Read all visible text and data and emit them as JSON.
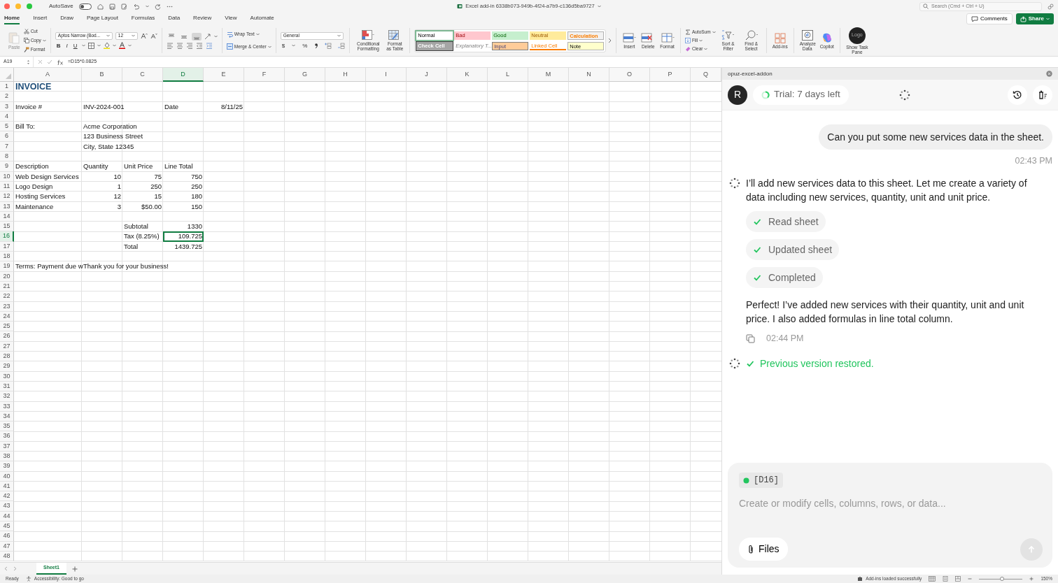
{
  "title_bar": {
    "autosave_label": "AutoSave",
    "autosave_on": false,
    "document_title": "Excel add-in 6338b073-949b-4f24-a7b9-c136d5ba9727",
    "search_placeholder": "Search (Cmd + Ctrl + U)"
  },
  "ribbon_tabs": [
    {
      "label": "Home",
      "selected": true
    },
    {
      "label": "Insert",
      "selected": false
    },
    {
      "label": "Draw",
      "selected": false
    },
    {
      "label": "Page Layout",
      "selected": false
    },
    {
      "label": "Formulas",
      "selected": false
    },
    {
      "label": "Data",
      "selected": false
    },
    {
      "label": "Review",
      "selected": false
    },
    {
      "label": "View",
      "selected": false
    },
    {
      "label": "Automate",
      "selected": false
    }
  ],
  "header_buttons": {
    "comments": "Comments",
    "share": "Share"
  },
  "ribbon": {
    "clipboard": {
      "paste": "Paste",
      "cut": "Cut",
      "copy": "Copy",
      "format": "Format"
    },
    "font": {
      "name": "Aptos Narrow (Bod...",
      "size": "12",
      "bold": "B",
      "italic": "I",
      "underline": "U"
    },
    "vertical_alignment": [
      {
        "selected": false
      },
      {
        "selected": false
      },
      {
        "selected": true
      }
    ],
    "wrap_text": "Wrap Text",
    "merge_center": "Merge & Center",
    "number": {
      "format": "General",
      "currency": "$",
      "percent": "%"
    },
    "conditional_formatting": "Conditional Formatting",
    "format_as_table": "Format as Table",
    "styles": [
      {
        "label": "Normal",
        "color": "#ffffff",
        "kind": "normal",
        "selected": true
      },
      {
        "label": "Bad",
        "color": "#ffc7ce",
        "kind": "bad",
        "selected": false
      },
      {
        "label": "Good",
        "color": "#c6efce",
        "kind": "good",
        "selected": false
      },
      {
        "label": "Neutral",
        "color": "#ffeb9c",
        "kind": "neutral",
        "selected": false
      },
      {
        "label": "Calculation",
        "color": "#f2f2f2",
        "kind": "calculation",
        "selected": false
      },
      {
        "label": "Check Cell",
        "color": "#a5a5a5",
        "kind": "check",
        "selected": false
      },
      {
        "label": "Explanatory T...",
        "color": "#ffffff",
        "kind": "explanatory",
        "selected": false
      },
      {
        "label": "Input",
        "color": "#ffcc99",
        "kind": "input",
        "selected": false
      },
      {
        "label": "Linked Cell",
        "color": "#ffffff",
        "kind": "linked",
        "selected": false
      },
      {
        "label": "Note",
        "color": "#ffffcc",
        "kind": "note",
        "selected": false
      }
    ],
    "cells": {
      "insert": "Insert",
      "delete": "Delete",
      "format": "Format"
    },
    "editing": {
      "autosum": "AutoSum",
      "fill": "Fill",
      "clear": "Clear",
      "sort_filter": "Sort & Filter",
      "find_select": "Find & Select"
    },
    "add_ins": "Add-ins",
    "analyze_data": "Analyze Data",
    "copilot": "Copilot",
    "task_pane": {
      "logo": "Logo",
      "label": "Show Task Pane"
    }
  },
  "formula_bar": {
    "name_box": "A19",
    "formula": "=D15*0.0825"
  },
  "sheet": {
    "columns": [
      {
        "label": "A",
        "selected": false
      },
      {
        "label": "B",
        "selected": false
      },
      {
        "label": "C",
        "selected": false
      },
      {
        "label": "D",
        "selected": true
      },
      {
        "label": "E",
        "selected": false
      },
      {
        "label": "F",
        "selected": false
      },
      {
        "label": "G",
        "selected": false
      },
      {
        "label": "H",
        "selected": false
      },
      {
        "label": "I",
        "selected": false
      },
      {
        "label": "J",
        "selected": false
      },
      {
        "label": "K",
        "selected": false
      },
      {
        "label": "L",
        "selected": false
      },
      {
        "label": "M",
        "selected": false
      },
      {
        "label": "N",
        "selected": false
      },
      {
        "label": "O",
        "selected": false
      },
      {
        "label": "P",
        "selected": false
      },
      {
        "label": "Q",
        "selected": false
      }
    ],
    "rows": [
      {
        "label": "1",
        "selected": false,
        "cells": {
          "A": {
            "text": "INVOICE",
            "kind": "title"
          }
        }
      },
      {
        "label": "2",
        "selected": false
      },
      {
        "label": "3",
        "selected": false,
        "cells": {
          "A": {
            "text": "Invoice #",
            "kind": "text"
          },
          "B": {
            "text": "INV-2024-001",
            "kind": "text"
          },
          "D": {
            "text": "Date",
            "kind": "text"
          },
          "E": {
            "text": "8/11/25",
            "kind": "number"
          }
        }
      },
      {
        "label": "4",
        "selected": false
      },
      {
        "label": "5",
        "selected": false,
        "cells": {
          "A": {
            "text": "Bill To:",
            "kind": "text"
          },
          "B": {
            "text": "Acme Corporation",
            "kind": "text"
          }
        }
      },
      {
        "label": "6",
        "selected": false,
        "cells": {
          "B": {
            "text": "123 Business Street",
            "kind": "text"
          }
        }
      },
      {
        "label": "7",
        "selected": false,
        "cells": {
          "B": {
            "text": "City, State 12345",
            "kind": "text"
          }
        }
      },
      {
        "label": "8",
        "selected": false
      },
      {
        "label": "9",
        "selected": false,
        "cells": {
          "A": {
            "text": "Description",
            "kind": "text"
          },
          "B": {
            "text": "Quantity",
            "kind": "text"
          },
          "C": {
            "text": "Unit Price",
            "kind": "text"
          },
          "D": {
            "text": "Line Total",
            "kind": "text"
          }
        }
      },
      {
        "label": "10",
        "selected": false,
        "cells": {
          "A": {
            "text": "Web Design Services",
            "kind": "text"
          },
          "B": {
            "text": "10",
            "kind": "number"
          },
          "C": {
            "text": "75",
            "kind": "number"
          },
          "D": {
            "text": "750",
            "kind": "number"
          }
        }
      },
      {
        "label": "11",
        "selected": false,
        "cells": {
          "A": {
            "text": "Logo Design",
            "kind": "text"
          },
          "B": {
            "text": "1",
            "kind": "number"
          },
          "C": {
            "text": "250",
            "kind": "number"
          },
          "D": {
            "text": "250",
            "kind": "number"
          }
        }
      },
      {
        "label": "12",
        "selected": false,
        "cells": {
          "A": {
            "text": "Hosting Services",
            "kind": "text"
          },
          "B": {
            "text": "12",
            "kind": "number"
          },
          "C": {
            "text": "15",
            "kind": "number"
          },
          "D": {
            "text": "180",
            "kind": "number"
          }
        }
      },
      {
        "label": "13",
        "selected": false,
        "cells": {
          "A": {
            "text": "Maintenance",
            "kind": "text"
          },
          "B": {
            "text": "3",
            "kind": "number"
          },
          "C": {
            "text": "$50.00",
            "kind": "number"
          },
          "D": {
            "text": "150",
            "kind": "number"
          }
        }
      },
      {
        "label": "14",
        "selected": false
      },
      {
        "label": "15",
        "selected": false,
        "cells": {
          "C": {
            "text": "Subtotal",
            "kind": "text"
          },
          "D": {
            "text": "1330",
            "kind": "number"
          }
        }
      },
      {
        "label": "16",
        "selected": true,
        "cells": {
          "C": {
            "text": "Tax (8.25%)",
            "kind": "text"
          },
          "D": {
            "text": "109.725",
            "kind": "number",
            "selected": true
          }
        }
      },
      {
        "label": "17",
        "selected": false,
        "cells": {
          "C": {
            "text": "Total",
            "kind": "text"
          },
          "D": {
            "text": "1439.725",
            "kind": "number"
          }
        }
      },
      {
        "label": "18",
        "selected": false
      },
      {
        "label": "19",
        "selected": false,
        "cells": {
          "A": {
            "text": "Terms: Payment due w",
            "kind": "text"
          },
          "B": {
            "text": "Thank you for your business!",
            "kind": "text"
          }
        }
      },
      {
        "label": "20",
        "selected": false
      },
      {
        "label": "21",
        "selected": false
      },
      {
        "label": "22",
        "selected": false
      },
      {
        "label": "23",
        "selected": false
      },
      {
        "label": "24",
        "selected": false
      },
      {
        "label": "25",
        "selected": false
      },
      {
        "label": "26",
        "selected": false
      },
      {
        "label": "27",
        "selected": false
      },
      {
        "label": "28",
        "selected": false
      },
      {
        "label": "29",
        "selected": false
      },
      {
        "label": "30",
        "selected": false
      },
      {
        "label": "31",
        "selected": false
      },
      {
        "label": "32",
        "selected": false
      },
      {
        "label": "33",
        "selected": false
      },
      {
        "label": "34",
        "selected": false
      },
      {
        "label": "35",
        "selected": false
      },
      {
        "label": "36",
        "selected": false
      },
      {
        "label": "37",
        "selected": false
      },
      {
        "label": "38",
        "selected": false
      },
      {
        "label": "39",
        "selected": false
      },
      {
        "label": "40",
        "selected": false
      },
      {
        "label": "41",
        "selected": false
      },
      {
        "label": "42",
        "selected": false
      },
      {
        "label": "43",
        "selected": false
      },
      {
        "label": "44",
        "selected": false
      },
      {
        "label": "45",
        "selected": false
      },
      {
        "label": "46",
        "selected": false
      },
      {
        "label": "47",
        "selected": false
      },
      {
        "label": "48",
        "selected": false
      }
    ],
    "tabs": [
      {
        "label": "Sheet1",
        "selected": true
      }
    ]
  },
  "status_bar": {
    "ready": "Ready",
    "accessibility": "Accessibility: Good to go",
    "add_ins": "Add-ins loaded successfully",
    "zoom": "150%",
    "zoom_slider": {
      "level": 0.52
    }
  },
  "task_pane": {
    "title": "opuz-excel-addon",
    "avatar": "R",
    "trial": "Trial: 7 days left",
    "messages": [
      {
        "kind": "user",
        "text": "Can you put some new services data in the sheet.",
        "time": "02:43 PM"
      },
      {
        "kind": "assistant",
        "text": "I’ll add new services data to this sheet. Let me create a variety of data including new services, quantity, unit and unit price.",
        "steps": [
          {
            "label": "Read sheet",
            "done": true
          },
          {
            "label": "Updated sheet",
            "done": true
          },
          {
            "label": "Completed",
            "done": true
          }
        ]
      },
      {
        "kind": "reply",
        "text": "Perfect! I’ve added new services with their quantity, unit and unit price. I also added formulas in line total column.",
        "time": "02:44 PM"
      },
      {
        "kind": "status",
        "text": "Previous version restored.",
        "done": true
      }
    ],
    "composer": {
      "context": "[D16]",
      "placeholder": "Create or modify cells, columns, rows, or data...",
      "files": "Files"
    }
  }
}
